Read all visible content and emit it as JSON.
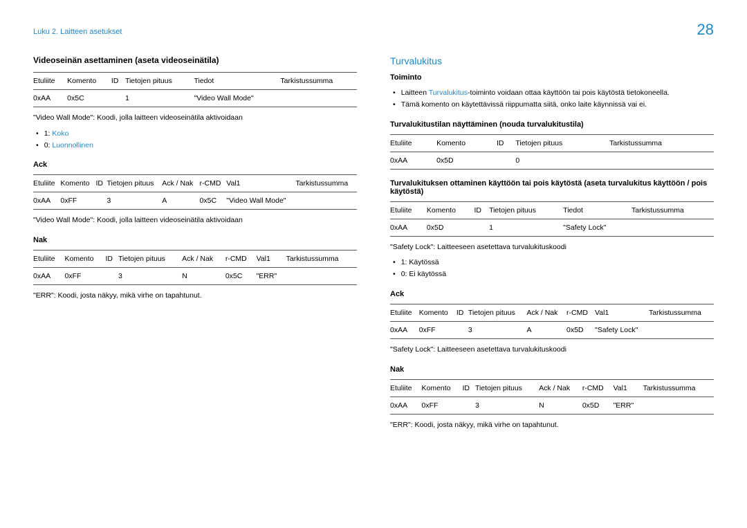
{
  "page_number": "28",
  "breadcrumb": "Luku 2. Laitteen asetukset",
  "left": {
    "heading": "Videoseinän asettaminen (aseta videoseinätila)",
    "table1": {
      "headers": [
        "Etuliite",
        "Komento",
        "ID",
        "Tietojen pituus",
        "Tiedot",
        "Tarkistussumma"
      ],
      "row": [
        "0xAA",
        "0x5C",
        "",
        "1",
        "\"Video Wall Mode\"",
        ""
      ]
    },
    "note1": "\"Video Wall Mode\": Koodi, jolla laitteen videoseinätila aktivoidaan",
    "bullets1": [
      {
        "prefix": "1: ",
        "text": "Koko"
      },
      {
        "prefix": "0: ",
        "text": "Luonnollinen"
      }
    ],
    "ack_label": "Ack",
    "table2": {
      "headers": [
        "Etuliite",
        "Komento",
        "ID",
        "Tietojen pituus",
        "Ack / Nak",
        "r-CMD",
        "Val1",
        "Tarkistussumma"
      ],
      "row": [
        "0xAA",
        "0xFF",
        "",
        "3",
        "A",
        "0x5C",
        "\"Video Wall Mode\"",
        ""
      ]
    },
    "note2": "\"Video Wall Mode\": Koodi, jolla laitteen videoseinätila aktivoidaan",
    "nak_label": "Nak",
    "table3": {
      "headers": [
        "Etuliite",
        "Komento",
        "ID",
        "Tietojen pituus",
        "Ack / Nak",
        "r-CMD",
        "Val1",
        "Tarkistussumma"
      ],
      "row": [
        "0xAA",
        "0xFF",
        "",
        "3",
        "N",
        "0x5C",
        "\"ERR\"",
        ""
      ]
    },
    "note3": "\"ERR\": Koodi, josta näkyy, mikä virhe on tapahtunut."
  },
  "right": {
    "heading_accent": "Turvalukitus",
    "subhead1": "Toiminto",
    "bullets1": [
      {
        "pre": "Laitteen ",
        "accent": "Turvalukitus",
        "post": "-toiminto voidaan ottaa käyttöön tai pois käytöstä tietokoneella."
      },
      {
        "pre": "Tämä komento on käytettävissä riippumatta siitä, onko laite käynnissä vai ei.",
        "accent": "",
        "post": ""
      }
    ],
    "subhead2": "Turvalukitustilan näyttäminen (nouda turvalukitustila)",
    "table1": {
      "headers": [
        "Etuliite",
        "Komento",
        "ID",
        "Tietojen pituus",
        "Tarkistussumma"
      ],
      "row": [
        "0xAA",
        "0x5D",
        "",
        "0",
        ""
      ]
    },
    "subhead3": "Turvalukituksen ottaminen käyttöön tai pois käytöstä (aseta turvalukitus käyttöön / pois käytöstä)",
    "table2": {
      "headers": [
        "Etuliite",
        "Komento",
        "ID",
        "Tietojen pituus",
        "Tiedot",
        "Tarkistussumma"
      ],
      "row": [
        "0xAA",
        "0x5D",
        "",
        "1",
        "\"Safety Lock\"",
        ""
      ]
    },
    "note1": "\"Safety Lock\": Laitteeseen asetettava turvalukituskoodi",
    "bullets2": [
      "1: Käytössä",
      "0: Ei käytössä"
    ],
    "ack_label": "Ack",
    "table3": {
      "headers": [
        "Etuliite",
        "Komento",
        "ID",
        "Tietojen pituus",
        "Ack / Nak",
        "r-CMD",
        "Val1",
        "Tarkistussumma"
      ],
      "row": [
        "0xAA",
        "0xFF",
        "",
        "3",
        "A",
        "0x5D",
        "\"Safety Lock\"",
        ""
      ]
    },
    "note2": "\"Safety Lock\": Laitteeseen asetettava turvalukituskoodi",
    "nak_label": "Nak",
    "table4": {
      "headers": [
        "Etuliite",
        "Komento",
        "ID",
        "Tietojen pituus",
        "Ack / Nak",
        "r-CMD",
        "Val1",
        "Tarkistussumma"
      ],
      "row": [
        "0xAA",
        "0xFF",
        "",
        "3",
        "N",
        "0x5D",
        "\"ERR\"",
        ""
      ]
    },
    "note3": "\"ERR\": Koodi, josta näkyy, mikä virhe on tapahtunut."
  }
}
